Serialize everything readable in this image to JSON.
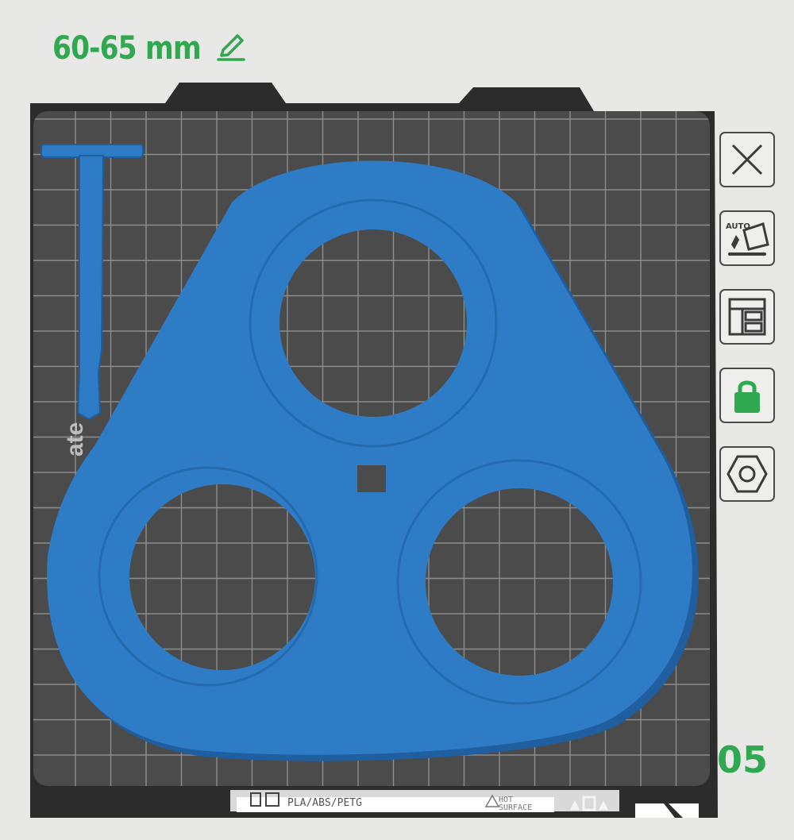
{
  "plate": {
    "name": "60-65 mm",
    "index": "05",
    "strip": {
      "filaments": "PLA/ABS/PETG",
      "hot_line1": "HOT",
      "hot_line2": "SURFACE"
    }
  },
  "toolbar": [
    {
      "id": "delete",
      "icon": "close-icon"
    },
    {
      "id": "auto-orient",
      "icon": "auto-orient-icon",
      "label": "AUTO"
    },
    {
      "id": "arrange",
      "icon": "arrange-layout-icon"
    },
    {
      "id": "lock",
      "icon": "lock-icon"
    },
    {
      "id": "plate-settings",
      "icon": "hex-nut-settings-icon"
    }
  ],
  "plate_label_fragment": "ate",
  "colors": {
    "accent": "#2fa84f",
    "model": "#2e7cc6",
    "model_edge": "#1f5e9f",
    "bed": "#4b4b4b",
    "bed_border": "#2c2c2c",
    "grid": "#8d8d8d",
    "background": "#e8e8e7"
  }
}
